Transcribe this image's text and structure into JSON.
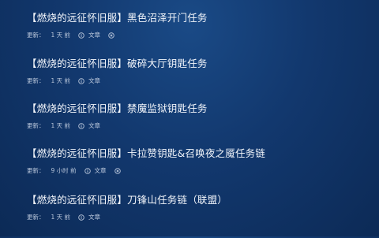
{
  "articles": [
    {
      "title": "【燃烧的远征怀旧服】黑色沼泽开门任务",
      "meta_label": "更新：",
      "time": "1 天 前",
      "category": "文章"
    },
    {
      "title": "【燃烧的远征怀旧服】破碎大厅钥匙任务",
      "meta_label": "更新：",
      "time": "1 天 前",
      "category": "文章"
    },
    {
      "title": "【燃烧的远征怀旧服】禁魔监狱钥匙任务",
      "meta_label": "更新：",
      "time": "1 天 前",
      "category": "文章"
    },
    {
      "title": "【燃烧的远征怀旧服】卡拉赞钥匙&召唤夜之魇任务链",
      "meta_label": "更新：",
      "time": "9 小时 前",
      "category": "文章"
    },
    {
      "title": "【燃烧的远征怀旧服】刀锋山任务链（联盟）",
      "meta_label": "更新：",
      "time": "1 天 前",
      "category": "文章"
    }
  ],
  "icons": {
    "info": "info-circle-icon",
    "close": "close-circle-icon"
  },
  "colors": {
    "background": "#12386e",
    "title": "#f3f6fb",
    "meta": "#b9c6da"
  }
}
